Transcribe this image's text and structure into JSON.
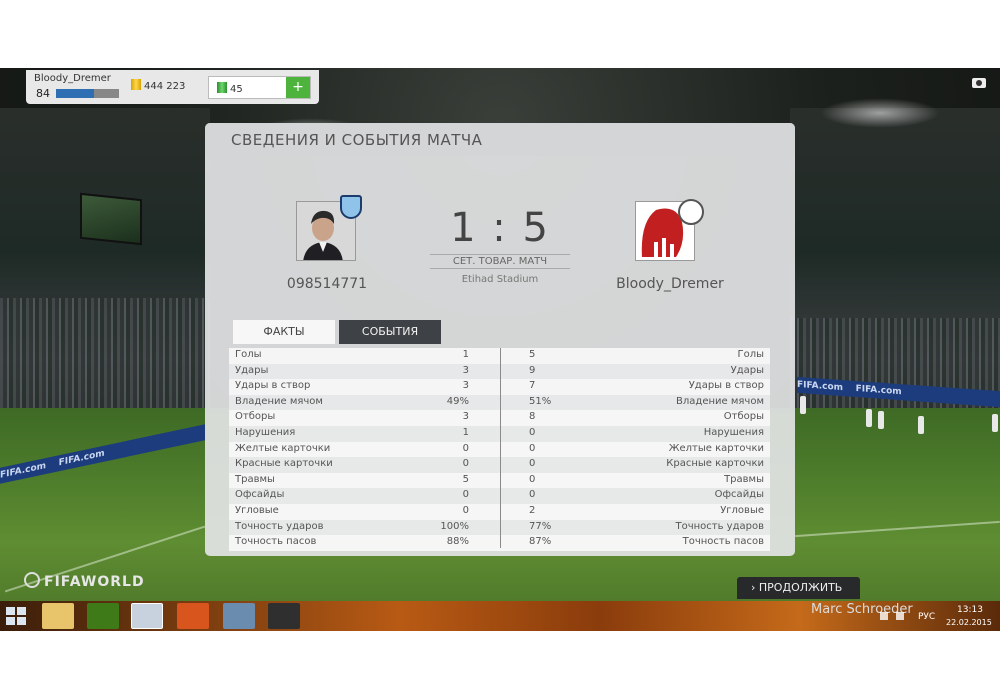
{
  "top_bar": {
    "username": "Bloody_Dremer",
    "level": "84",
    "xp_progress": 0.6,
    "coins": "444 223",
    "points": "45",
    "add_points": "+"
  },
  "panel": {
    "title": "СВЕДЕНИЯ И СОБЫТИЯ МАТЧА",
    "score": "1 : 5",
    "match_type": "СЕТ. ТОВАР. МАТЧ",
    "stadium": "Etihad Stadium",
    "home_name": "098514771",
    "away_name": "Bloody_Dremer",
    "tabs": [
      {
        "label": "ФАКТЫ",
        "active": false
      },
      {
        "label": "СОБЫТИЯ",
        "active": true
      }
    ],
    "stats": [
      {
        "label": "Голы",
        "home": "1",
        "away": "5"
      },
      {
        "label": "Удары",
        "home": "3",
        "away": "9"
      },
      {
        "label": "Удары в створ",
        "home": "3",
        "away": "7"
      },
      {
        "label": "Владение мячом",
        "home": "49%",
        "away": "51%"
      },
      {
        "label": "Отборы",
        "home": "3",
        "away": "8"
      },
      {
        "label": "Нарушения",
        "home": "1",
        "away": "0"
      },
      {
        "label": "Желтые карточки",
        "home": "0",
        "away": "0"
      },
      {
        "label": "Красные карточки",
        "home": "0",
        "away": "0"
      },
      {
        "label": "Травмы",
        "home": "5",
        "away": "0"
      },
      {
        "label": "Офсайды",
        "home": "0",
        "away": "0"
      },
      {
        "label": "Угловые",
        "home": "0",
        "away": "2"
      },
      {
        "label": "Точность ударов",
        "home": "100%",
        "away": "77%"
      },
      {
        "label": "Точность пасов",
        "home": "88%",
        "away": "87%"
      }
    ]
  },
  "footer": {
    "brand": "FIFAWORLD",
    "continue_label": "ПРОДОЛЖИТЬ"
  },
  "taskbar": {
    "user": "Marc Schroeder",
    "lang": "РУС",
    "time": "13:13",
    "date": "22.02.2015"
  },
  "stadium_boards": [
    "FIFA.com",
    "FIFA.com",
    "FIFA.com",
    "FIFA.com"
  ],
  "colors": {
    "accent_green": "#4db33d",
    "xp_blue": "#2d6fb2",
    "events_tab": "#3e4145"
  }
}
